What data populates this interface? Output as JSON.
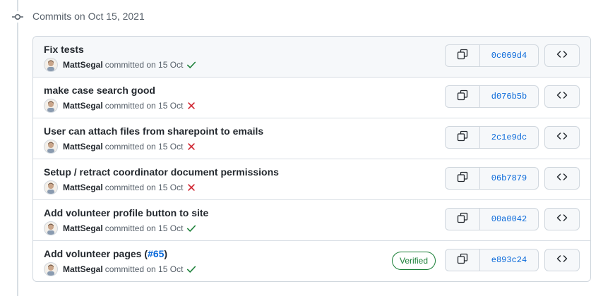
{
  "group": {
    "title": "Commits on Oct 15, 2021"
  },
  "commits": [
    {
      "title": "Fix tests",
      "author": "MattSegal",
      "action": "committed on 15 Oct",
      "status": "success",
      "sha": "0c069d4"
    },
    {
      "title": "make case search good",
      "author": "MattSegal",
      "action": "committed on 15 Oct",
      "status": "failure",
      "sha": "d076b5b"
    },
    {
      "title": "User can attach files from sharepoint to emails",
      "author": "MattSegal",
      "action": "committed on 15 Oct",
      "status": "failure",
      "sha": "2c1e9dc"
    },
    {
      "title": "Setup / retract coordinator document permissions",
      "author": "MattSegal",
      "action": "committed on 15 Oct",
      "status": "failure",
      "sha": "06b7879"
    },
    {
      "title": "Add volunteer profile button to site",
      "author": "MattSegal",
      "action": "committed on 15 Oct",
      "status": "success",
      "sha": "00a0042"
    },
    {
      "title": "Add volunteer pages (",
      "pr_link": "#65",
      "title_suffix": ")",
      "author": "MattSegal",
      "action": "committed on 15 Oct",
      "status": "success",
      "verified": "Verified",
      "sha": "e893c24"
    }
  ],
  "colors": {
    "success": "#1a7f37",
    "failure": "#cf222e",
    "link": "#0969da"
  },
  "icons": {
    "timeline": "git-commit-icon",
    "copy": "copy-icon",
    "browse": "code-icon",
    "success": "check-icon",
    "failure": "x-icon"
  }
}
